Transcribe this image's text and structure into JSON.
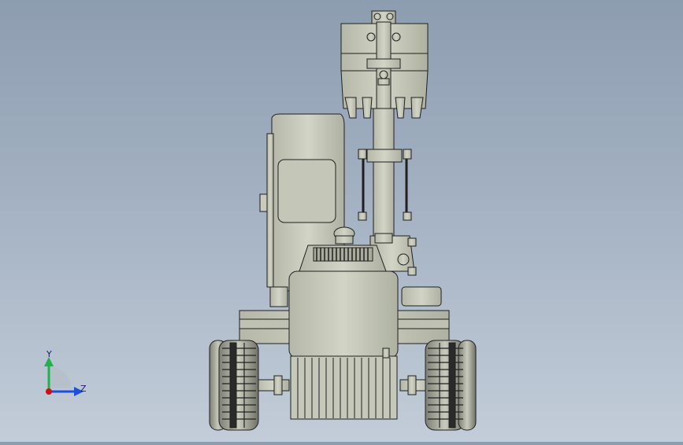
{
  "viewport": {
    "background_top": "#8d9db0",
    "background_bottom": "#c3cdd9",
    "model_color": "#c9cbbc",
    "edge_color": "#202020"
  },
  "triad": {
    "y_label": "Y",
    "z_label": "Z",
    "y_color": "#22b14c",
    "z_color": "#1e4fd8",
    "x_color": "#d01010"
  }
}
